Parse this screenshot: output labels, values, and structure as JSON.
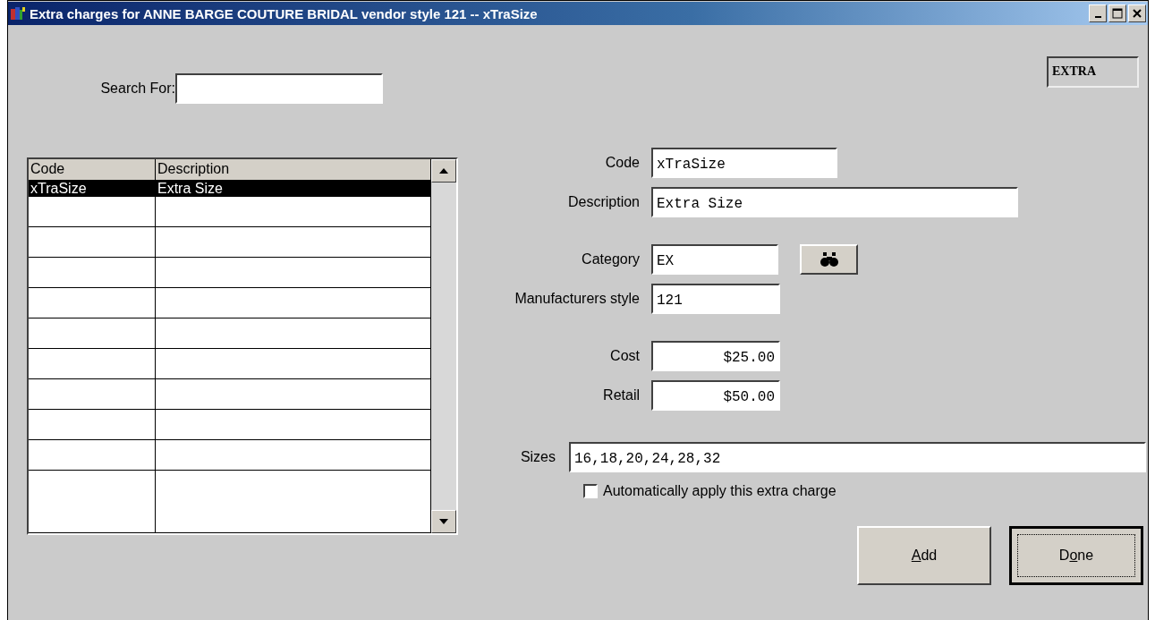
{
  "window": {
    "title": "Extra charges for ANNE BARGE COUTURE BRIDAL vendor style 121 -- xTraSize"
  },
  "mode_badge": "EXTRA",
  "search": {
    "label": "Search For:"
  },
  "table": {
    "columns": [
      "Code",
      "Description"
    ],
    "rows": [
      {
        "cells": [
          "xTraSize",
          "Extra Size"
        ],
        "selected": true
      }
    ]
  },
  "field_groups": [
    [
      {
        "label": "Code",
        "value": "xTraSize"
      },
      {
        "label": "Description",
        "value": "Extra Size"
      }
    ],
    [
      {
        "label": "Category",
        "value": "EX",
        "lookup": true
      },
      {
        "label": "Manufacturers style",
        "value": "121"
      }
    ],
    [
      {
        "label": "Cost",
        "value": "$25.00",
        "kind": "money"
      },
      {
        "label": "Retail",
        "value": "$50.00",
        "kind": "money"
      }
    ]
  ],
  "sizes": {
    "label": "Sizes",
    "value": "16,18,20,24,28,32"
  },
  "auto_apply": {
    "label": "Automatically apply this extra charge",
    "checked": false
  },
  "buttons": [
    {
      "underlined": "A",
      "after": "dd",
      "default": false
    },
    {
      "before": "D",
      "underlined": "o",
      "after": "ne",
      "default": true
    }
  ]
}
